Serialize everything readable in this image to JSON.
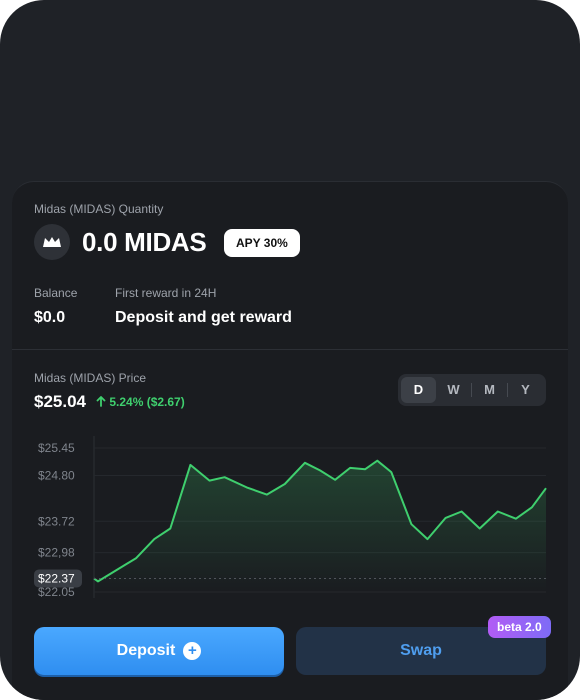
{
  "holding": {
    "quantity_label": "Midas (MIDAS) Quantity",
    "coin_icon": "midas-crown-icon",
    "quantity_value": "0.0 MIDAS",
    "apy_badge": "APY 30%",
    "balance_label": "Balance",
    "balance_value": "$0.0",
    "reward_label": "First reward in 24H",
    "reward_value": "Deposit and get reward"
  },
  "price": {
    "label": "Midas (MIDAS) Price",
    "value": "$25.04",
    "change": "5.24% ($2.67)",
    "change_icon": "arrow-up-icon",
    "periods": [
      "D",
      "W",
      "M",
      "Y"
    ],
    "active_period": "D"
  },
  "chart_data": {
    "type": "line",
    "y_ticks": [
      "$25.45",
      "$24.80",
      "$23.72",
      "$22,98",
      "$22.05"
    ],
    "ylim": [
      22.05,
      25.45
    ],
    "current_label": "$22.37",
    "current_value": 22.37,
    "color": "#3fcf6e",
    "values": [
      22.37,
      22.3,
      22.85,
      23.3,
      23.55,
      25.05,
      24.68,
      24.76,
      24.52,
      24.35,
      24.6,
      25.1,
      24.92,
      24.7,
      24.98,
      24.95,
      25.15,
      24.88,
      23.65,
      23.3,
      23.8,
      23.95,
      23.55,
      23.95,
      23.78,
      24.05,
      24.5
    ],
    "x": [
      0,
      4,
      42,
      60,
      76,
      96,
      115,
      130,
      152,
      172,
      190,
      210,
      225,
      240,
      255,
      270,
      282,
      296,
      316,
      332,
      350,
      366,
      384,
      402,
      420,
      436,
      450
    ]
  },
  "actions": {
    "deposit_label": "Deposit",
    "deposit_icon": "plus-circle-icon",
    "swap_label": "Swap",
    "beta_badge": "beta 2.0"
  }
}
